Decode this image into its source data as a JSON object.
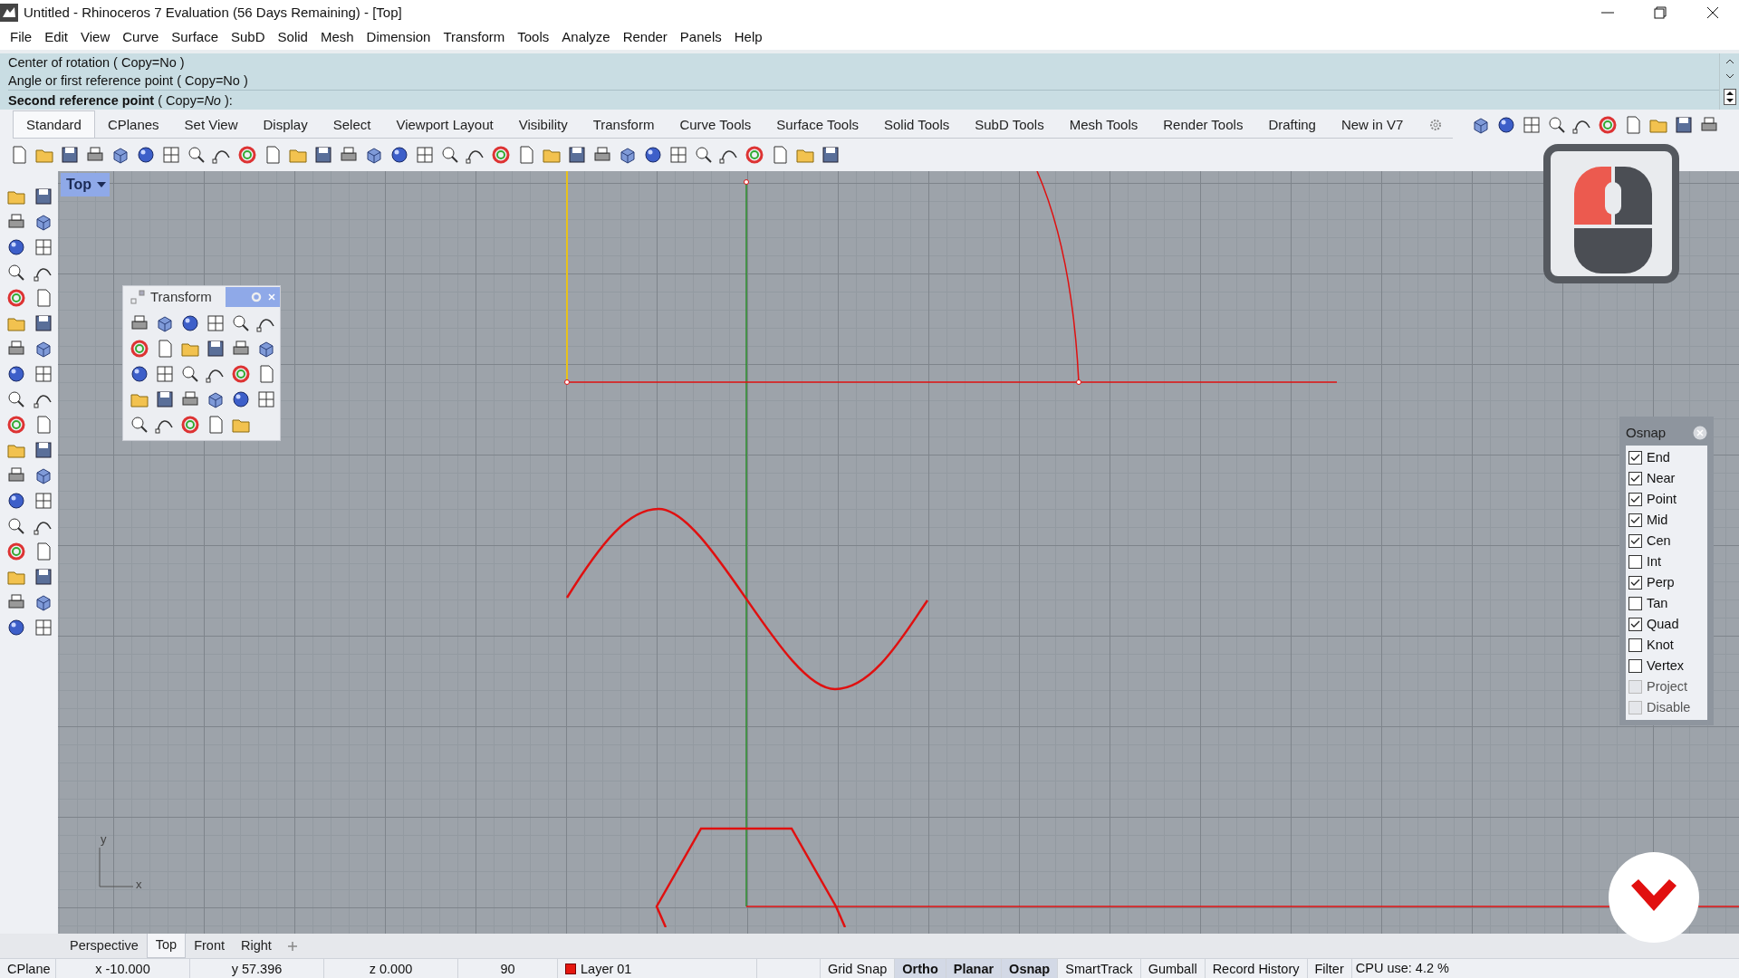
{
  "window": {
    "title": "Untitled - Rhinoceros 7 Evaluation (56 Days Remaining) - [Top]"
  },
  "menu": [
    "File",
    "Edit",
    "View",
    "Curve",
    "Surface",
    "SubD",
    "Solid",
    "Mesh",
    "Dimension",
    "Transform",
    "Tools",
    "Analyze",
    "Render",
    "Panels",
    "Help"
  ],
  "command_history": [
    "Center of rotation ( Copy=No )",
    "Angle or first reference point ( Copy=No )"
  ],
  "command_prompt": "**Second reference point** ( Copy=*No* ):",
  "toolbar_tabs": [
    {
      "label": "Standard",
      "selected": true
    },
    {
      "label": "CPlanes",
      "selected": false
    },
    {
      "label": "Set View",
      "selected": false
    },
    {
      "label": "Display",
      "selected": false
    },
    {
      "label": "Select",
      "selected": false
    },
    {
      "label": "Viewport Layout",
      "selected": false
    },
    {
      "label": "Visibility",
      "selected": false
    },
    {
      "label": "Transform",
      "selected": false
    },
    {
      "label": "Curve Tools",
      "selected": false
    },
    {
      "label": "Surface Tools",
      "selected": false
    },
    {
      "label": "Solid Tools",
      "selected": false
    },
    {
      "label": "SubD Tools",
      "selected": false
    },
    {
      "label": "Mesh Tools",
      "selected": false
    },
    {
      "label": "Render Tools",
      "selected": false
    },
    {
      "label": "Drafting",
      "selected": false
    },
    {
      "label": "New in V7",
      "selected": false
    }
  ],
  "viewport": {
    "title": "Top",
    "axis_y": "y",
    "axis_x": "x"
  },
  "transform_panel": {
    "title": "Transform"
  },
  "osnap": {
    "title": "Osnap",
    "items": [
      {
        "label": "End",
        "checked": true,
        "disabled": false
      },
      {
        "label": "Near",
        "checked": true,
        "disabled": false
      },
      {
        "label": "Point",
        "checked": true,
        "disabled": false
      },
      {
        "label": "Mid",
        "checked": true,
        "disabled": false
      },
      {
        "label": "Cen",
        "checked": true,
        "disabled": false
      },
      {
        "label": "Int",
        "checked": false,
        "disabled": false
      },
      {
        "label": "Perp",
        "checked": true,
        "disabled": false
      },
      {
        "label": "Tan",
        "checked": false,
        "disabled": false
      },
      {
        "label": "Quad",
        "checked": true,
        "disabled": false
      },
      {
        "label": "Knot",
        "checked": false,
        "disabled": false
      },
      {
        "label": "Vertex",
        "checked": false,
        "disabled": false
      },
      {
        "label": "Project",
        "checked": false,
        "disabled": true
      },
      {
        "label": "Disable",
        "checked": false,
        "disabled": true
      }
    ]
  },
  "viewport_tabs": [
    {
      "label": "Perspective",
      "selected": false
    },
    {
      "label": "Top",
      "selected": true
    },
    {
      "label": "Front",
      "selected": false
    },
    {
      "label": "Right",
      "selected": false
    }
  ],
  "status_bar": {
    "cplane": "CPlane",
    "x": "x -10.000",
    "y": "y 57.396",
    "z": "z 0.000",
    "angle": "90",
    "layer": {
      "label": "Layer 01",
      "color": "#e5170f"
    },
    "toggles": [
      {
        "label": "Grid Snap",
        "on": false
      },
      {
        "label": "Ortho",
        "on": true
      },
      {
        "label": "Planar",
        "on": true
      },
      {
        "label": "Osnap",
        "on": true
      },
      {
        "label": "SmartTrack",
        "on": false
      },
      {
        "label": "Gumball",
        "on": false
      },
      {
        "label": "Record History",
        "on": false
      },
      {
        "label": "Filter",
        "on": false
      }
    ],
    "cpu": "CPU use: 4.2 %"
  }
}
